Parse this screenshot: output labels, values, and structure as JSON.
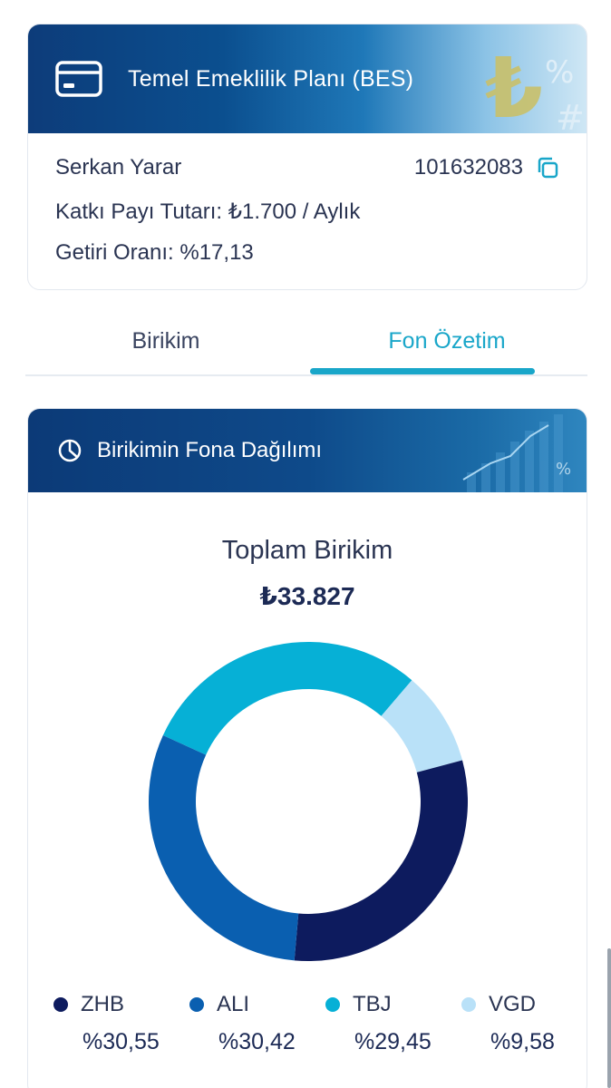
{
  "plan": {
    "title": "Temel Emeklilik Planı (BES)",
    "holder_name": "Serkan Yarar",
    "contract_no": "101632083",
    "contribution_line": "Katkı Payı Tutarı: ₺1.700 / Aylık",
    "return_line": "Getiri Oranı: %17,13",
    "icons": {
      "card": "credit-card-icon",
      "copy": "copy-icon"
    }
  },
  "tabs": [
    {
      "label": "Birikim",
      "active": false
    },
    {
      "label": "Fon Özetim",
      "active": true
    }
  ],
  "distribution": {
    "title": "Birikimin Fona Dağılımı",
    "icon": "pie-chart-icon",
    "total_label": "Toplam Birikim",
    "total_value": "₺33.827"
  },
  "colors": {
    "accent": "#19a6c9",
    "header_dark": "#0c3a77"
  },
  "chart_data": {
    "type": "pie",
    "donut": true,
    "categories": [
      "ZHB",
      "ALI",
      "TBJ",
      "VGD"
    ],
    "values": [
      30.55,
      30.42,
      29.45,
      9.58
    ],
    "labels": [
      "%30,55",
      "%30,42",
      "%29,45",
      "%9,58"
    ],
    "colors": [
      "#0d1b5e",
      "#0a5fb0",
      "#06b0d6",
      "#b9e1f8"
    ]
  }
}
